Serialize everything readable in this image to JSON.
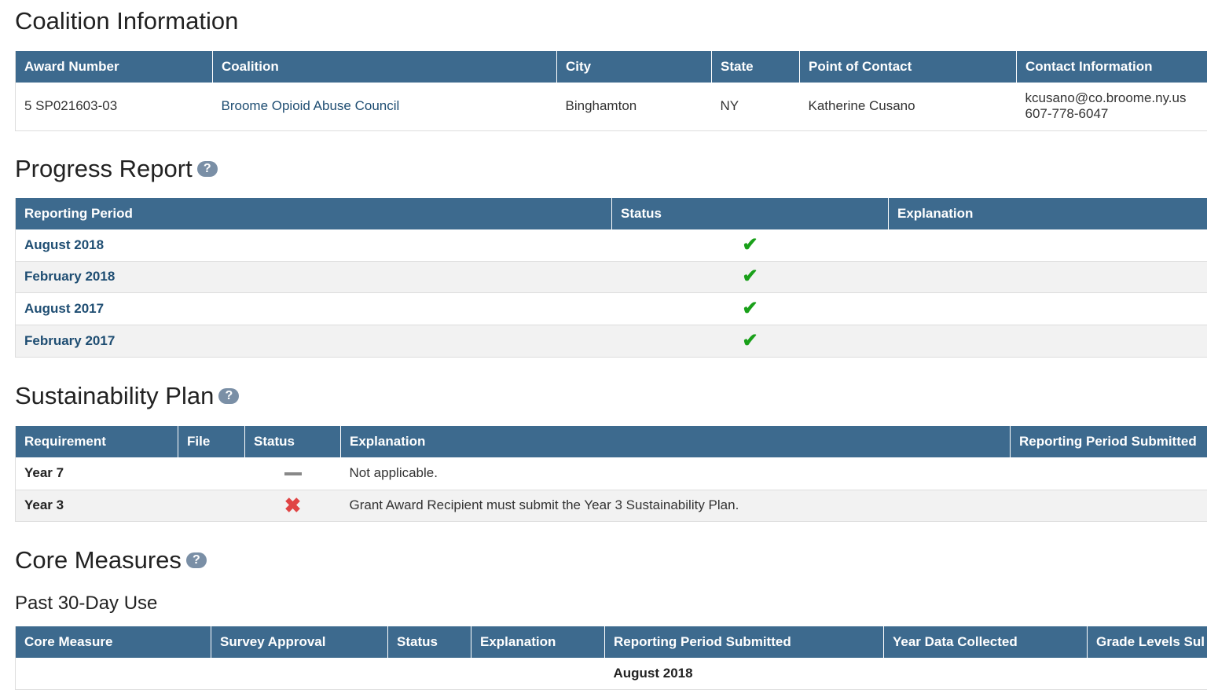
{
  "coalition": {
    "title": "Coalition Information",
    "headers": [
      "Award Number",
      "Coalition",
      "City",
      "State",
      "Point of Contact",
      "Contact Information"
    ],
    "row": {
      "award_number": "5 SP021603-03",
      "coalition": "Broome Opioid Abuse Council",
      "city": "Binghamton",
      "state": "NY",
      "contact": "Katherine Cusano",
      "email": "kcusano@co.broome.ny.us",
      "phone": "607-778-6047"
    }
  },
  "progress": {
    "title": "Progress Report",
    "help": "?",
    "headers": [
      "Reporting Period",
      "Status",
      "Explanation"
    ],
    "rows": [
      {
        "period": "August 2018",
        "status": "✔",
        "explanation": ""
      },
      {
        "period": "February 2018",
        "status": "✔",
        "explanation": ""
      },
      {
        "period": "August 2017",
        "status": "✔",
        "explanation": ""
      },
      {
        "period": "February 2017",
        "status": "✔",
        "explanation": ""
      }
    ]
  },
  "sustainability": {
    "title": "Sustainability Plan",
    "help": "?",
    "headers": [
      "Requirement",
      "File",
      "Status",
      "Explanation",
      "Reporting Period Submitted"
    ],
    "rows": [
      {
        "requirement": "Year 7",
        "file": "",
        "status_icon": "dash-icon",
        "explanation": "Not applicable.",
        "period": ""
      },
      {
        "requirement": "Year 3",
        "file": "",
        "status_icon": "x-icon",
        "status_glyph": "✖",
        "explanation": "Grant Award Recipient must submit the Year 3 Sustainability Plan.",
        "period": ""
      }
    ]
  },
  "core": {
    "title": "Core Measures",
    "help": "?",
    "subtitle": "Past 30-Day Use",
    "headers": [
      "Core Measure",
      "Survey Approval",
      "Status",
      "Explanation",
      "Reporting Period Submitted",
      "Year Data Collected",
      "Grade Levels Sul"
    ],
    "first_row_period": "August 2018"
  },
  "colors": {
    "header_bg": "#3d6a8e",
    "link": "#1e4d72",
    "check": "#1aa01a",
    "cross": "#e04444",
    "zebra": "#f2f2f2"
  }
}
